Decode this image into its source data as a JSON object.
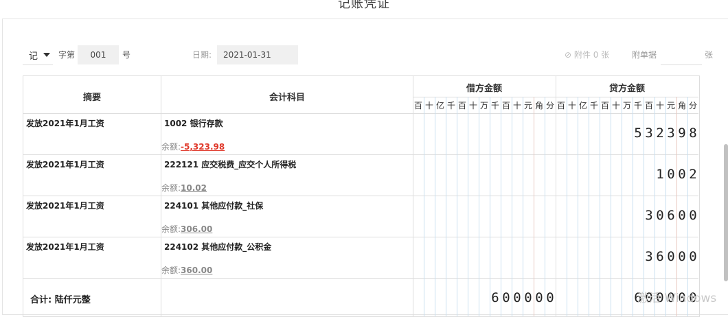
{
  "title": "记账凭证",
  "voucher": {
    "type": "记",
    "label_zi_di": "字第",
    "number": "001",
    "label_hao": "号",
    "date_label": "日期:",
    "date": "2021-01-31",
    "attachment_label": "附件 0 张",
    "attach_doc_label": "附单据",
    "zhang": "张"
  },
  "table": {
    "summary_header": "摘要",
    "account_header": "会计科目",
    "debit_header": "借方金额",
    "credit_header": "贷方金额",
    "units": [
      "百",
      "十",
      "亿",
      "千",
      "百",
      "十",
      "万",
      "千",
      "百",
      "十",
      "元",
      "角",
      "分"
    ],
    "balance_prefix": "余额:",
    "rows": [
      {
        "summary": "发放2021年1月工资",
        "account": "1002 银行存款",
        "balance": "-5,323.98",
        "debit": "",
        "credit": "532398"
      },
      {
        "summary": "发放2021年1月工资",
        "account": "222121 应交税费_应交个人所得税",
        "balance": "10.02",
        "debit": "",
        "credit": "1002"
      },
      {
        "summary": "发放2021年1月工资",
        "account": "224101 其他应付款_社保",
        "balance": "306.00",
        "debit": "",
        "credit": "30600"
      },
      {
        "summary": "发放2021年1月工资",
        "account": "224102 其他应付款_公积金",
        "balance": "360.00",
        "debit": "",
        "credit": "36000"
      }
    ],
    "total_label": "合计:  陆仟元整",
    "total_debit": "600000",
    "total_credit": "600000"
  },
  "watermark": "激活 Windows"
}
